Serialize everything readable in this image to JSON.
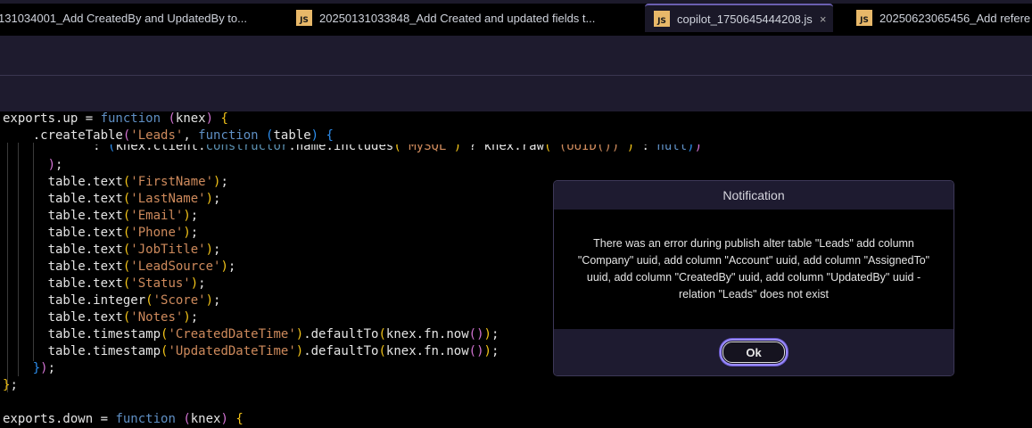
{
  "tabs": [
    {
      "label": "131034001_Add CreatedBy and UpdatedBy to...",
      "icon": "js-file-icon",
      "active": false
    },
    {
      "label": "20250131033848_Add Created and updated fields t...",
      "icon": "js-file-icon",
      "active": false
    },
    {
      "label": "copilot_1750645444208.js",
      "icon": "js-file-icon",
      "active": true,
      "close": "×"
    },
    {
      "label": "20250623065456_Add refere",
      "icon": "js-file-icon",
      "active": false
    }
  ],
  "js_icon_label": "JS",
  "code_lines": [
    [
      [
        "exports.up = ",
        ""
      ],
      [
        "function",
        "kw"
      ],
      [
        " ",
        ""
      ],
      [
        "(",
        "b2"
      ],
      [
        "knex",
        ""
      ],
      [
        ")",
        "b2"
      ],
      [
        " ",
        ""
      ],
      [
        "{",
        "b1"
      ]
    ],
    [
      [
        "    .createTable",
        ""
      ],
      [
        "(",
        "b2"
      ],
      [
        "'Leads'",
        "str"
      ],
      [
        ", ",
        ""
      ],
      [
        "function",
        "kw"
      ],
      [
        " ",
        ""
      ],
      [
        "(",
        "b3"
      ],
      [
        "table",
        ""
      ],
      [
        ")",
        "b3"
      ],
      [
        " ",
        ""
      ],
      [
        "{",
        "b3"
      ]
    ],
    [
      [
        "            : ",
        ""
      ],
      [
        "(",
        "b3"
      ],
      [
        "knex.client.",
        ""
      ],
      [
        "constructor",
        "mem"
      ],
      [
        ".name.includes",
        ""
      ],
      [
        "(",
        "b1"
      ],
      [
        "'MySQL'",
        "str"
      ],
      [
        ")",
        "b1"
      ],
      [
        " ? knex.raw",
        ""
      ],
      [
        "(",
        "b1"
      ],
      [
        "'(UUID())'",
        "str"
      ],
      [
        ")",
        "b1"
      ],
      [
        " : ",
        ""
      ],
      [
        "null",
        "kw"
      ],
      [
        ")",
        "b3"
      ],
      [
        ")",
        "b2"
      ]
    ],
    [
      [
        "      ",
        ""
      ],
      [
        ")",
        "b2"
      ],
      [
        ";",
        ""
      ]
    ],
    [
      [
        "      table.text",
        ""
      ],
      [
        "(",
        "b1"
      ],
      [
        "'FirstName'",
        "str"
      ],
      [
        ")",
        "b1"
      ],
      [
        ";",
        ""
      ]
    ],
    [
      [
        "      table.text",
        ""
      ],
      [
        "(",
        "b1"
      ],
      [
        "'LastName'",
        "str"
      ],
      [
        ")",
        "b1"
      ],
      [
        ";",
        ""
      ]
    ],
    [
      [
        "      table.text",
        ""
      ],
      [
        "(",
        "b1"
      ],
      [
        "'Email'",
        "str"
      ],
      [
        ")",
        "b1"
      ],
      [
        ";",
        ""
      ]
    ],
    [
      [
        "      table.text",
        ""
      ],
      [
        "(",
        "b1"
      ],
      [
        "'Phone'",
        "str"
      ],
      [
        ")",
        "b1"
      ],
      [
        ";",
        ""
      ]
    ],
    [
      [
        "      table.text",
        ""
      ],
      [
        "(",
        "b1"
      ],
      [
        "'JobTitle'",
        "str"
      ],
      [
        ")",
        "b1"
      ],
      [
        ";",
        ""
      ]
    ],
    [
      [
        "      table.text",
        ""
      ],
      [
        "(",
        "b1"
      ],
      [
        "'LeadSource'",
        "str"
      ],
      [
        ")",
        "b1"
      ],
      [
        ";",
        ""
      ]
    ],
    [
      [
        "      table.text",
        ""
      ],
      [
        "(",
        "b1"
      ],
      [
        "'Status'",
        "str"
      ],
      [
        ")",
        "b1"
      ],
      [
        ";",
        ""
      ]
    ],
    [
      [
        "      table.integer",
        ""
      ],
      [
        "(",
        "b1"
      ],
      [
        "'Score'",
        "str"
      ],
      [
        ")",
        "b1"
      ],
      [
        ";",
        ""
      ]
    ],
    [
      [
        "      table.text",
        ""
      ],
      [
        "(",
        "b1"
      ],
      [
        "'Notes'",
        "str"
      ],
      [
        ")",
        "b1"
      ],
      [
        ";",
        ""
      ]
    ],
    [
      [
        "      table.timestamp",
        ""
      ],
      [
        "(",
        "b1"
      ],
      [
        "'CreatedDateTime'",
        "str"
      ],
      [
        ")",
        "b1"
      ],
      [
        ".defaultTo",
        ""
      ],
      [
        "(",
        "b1"
      ],
      [
        "knex.fn.now",
        ""
      ],
      [
        "()",
        "b2"
      ],
      [
        ")",
        "b1"
      ],
      [
        ";",
        ""
      ]
    ],
    [
      [
        "      table.timestamp",
        ""
      ],
      [
        "(",
        "b1"
      ],
      [
        "'UpdatedDateTime'",
        "str"
      ],
      [
        ")",
        "b1"
      ],
      [
        ".defaultTo",
        ""
      ],
      [
        "(",
        "b1"
      ],
      [
        "knex.fn.now",
        ""
      ],
      [
        "()",
        "b2"
      ],
      [
        ")",
        "b1"
      ],
      [
        ";",
        ""
      ]
    ],
    [
      [
        "    ",
        ""
      ],
      [
        "}",
        "b3"
      ],
      [
        ")",
        "b2"
      ],
      [
        ";",
        ""
      ]
    ],
    [
      [
        "}",
        "b1"
      ],
      [
        ";",
        ""
      ]
    ],
    [
      [
        "",
        ""
      ]
    ],
    [
      [
        "exports.down = ",
        ""
      ],
      [
        "function",
        "kw"
      ],
      [
        " ",
        ""
      ],
      [
        "(",
        "b2"
      ],
      [
        "knex",
        ""
      ],
      [
        ")",
        "b2"
      ],
      [
        " ",
        ""
      ],
      [
        "{",
        "b1"
      ]
    ]
  ],
  "dialog": {
    "title": "Notification",
    "message": "There was an error during publish alter table \"Leads\" add column \"Company\" uuid, add column \"Account\" uuid, add column \"AssignedTo\" uuid, add column \"CreatedBy\" uuid, add column \"UpdatedBy\" uuid - relation \"Leads\" does not exist",
    "ok_label": "Ok"
  }
}
